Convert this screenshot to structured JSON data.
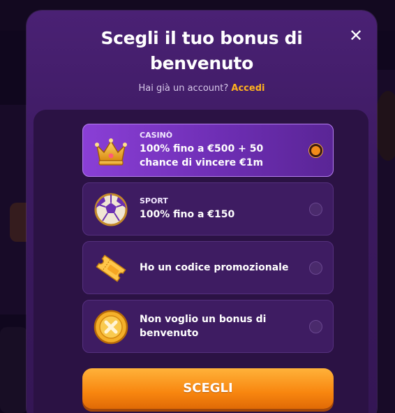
{
  "modal": {
    "title_line1": "Scegli il tuo bonus di",
    "title_line2": "benvenuto",
    "account_prompt": "Hai già un account?",
    "login_link": "Accedi"
  },
  "options": [
    {
      "category": "CASINÒ",
      "text_line1": "100% fino a €500 + 50",
      "text_line2": "chance di vincere €1m",
      "icon": "crown-icon",
      "selected": true
    },
    {
      "category": "SPORT",
      "text_line1": "100% fino a €150",
      "icon": "soccer-ball-icon",
      "selected": false
    },
    {
      "text_line1": "Ho un codice promozionale",
      "icon": "ticket-icon",
      "selected": false
    },
    {
      "text_line1": "Non voglio un bonus di",
      "text_line2": "benvenuto",
      "icon": "no-bonus-coin-icon",
      "selected": false
    }
  ],
  "cta": {
    "label": "SCEGLI"
  },
  "colors": {
    "accent": "#f8860f",
    "link": "#ffb21e",
    "modal_bg": "#3c1a60",
    "selected_bg": "#8a3fd6"
  }
}
